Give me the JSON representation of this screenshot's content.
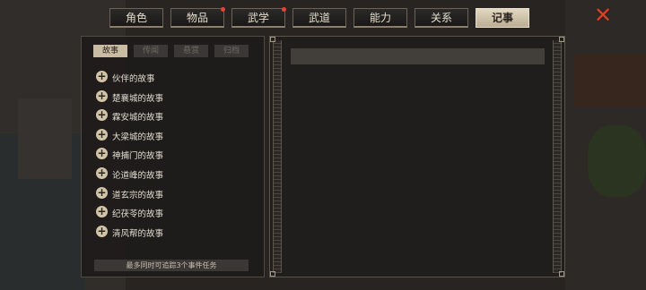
{
  "tabs": [
    {
      "label": "角色",
      "active": false,
      "notify": false
    },
    {
      "label": "物品",
      "active": false,
      "notify": true
    },
    {
      "label": "武学",
      "active": false,
      "notify": true
    },
    {
      "label": "武道",
      "active": false,
      "notify": false
    },
    {
      "label": "能力",
      "active": false,
      "notify": false
    },
    {
      "label": "关系",
      "active": false,
      "notify": false
    },
    {
      "label": "记事",
      "active": true,
      "notify": false
    }
  ],
  "close_icon": "close-x-icon",
  "subtabs": [
    {
      "label": "故事",
      "active": true
    },
    {
      "label": "传闻",
      "active": false
    },
    {
      "label": "悬赏",
      "active": false
    },
    {
      "label": "归档",
      "active": false
    }
  ],
  "stories": [
    "伙伴的故事",
    "楚襄城的故事",
    "霖安城的故事",
    "大梁城的故事",
    "神捕门的故事",
    "论道峰的故事",
    "道玄宗的故事",
    "纪茯苓的故事",
    "清风帮的故事"
  ],
  "footer_note": "最多同时可追踪3个事件任务",
  "colors": {
    "accent_tab": "#d6cab2",
    "notify_dot": "#e04535",
    "close": "#d8402c"
  }
}
